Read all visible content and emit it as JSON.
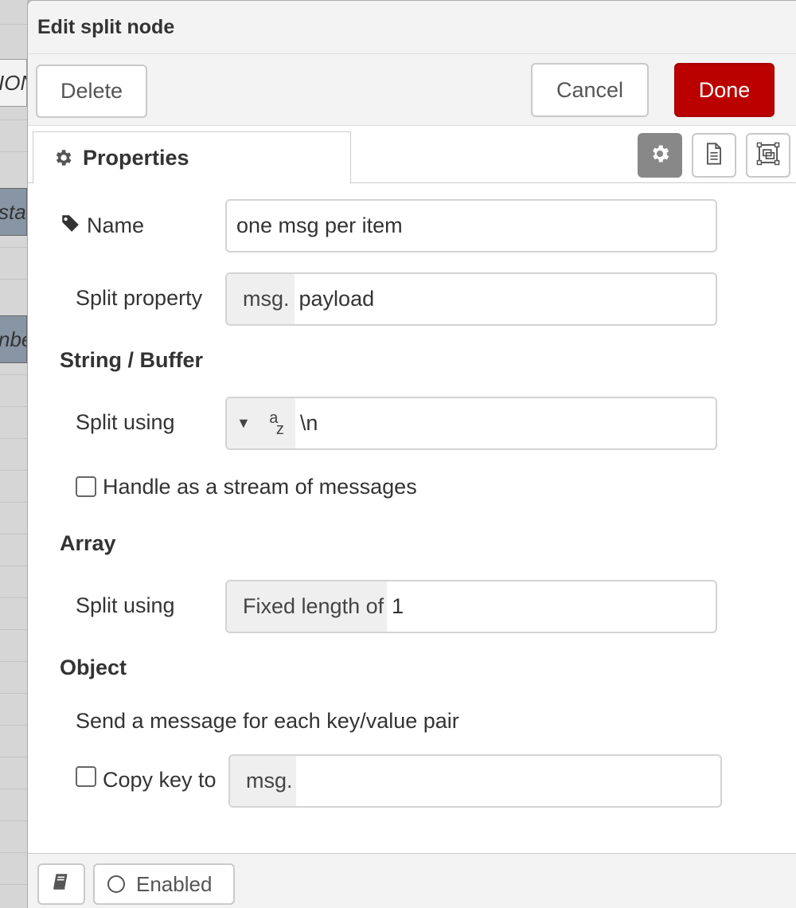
{
  "background": {
    "node_fragments": [
      "ION",
      "sta",
      "nbe"
    ]
  },
  "dialog": {
    "title": "Edit split node",
    "buttons": {
      "delete": "Delete",
      "cancel": "Cancel",
      "done": "Done"
    },
    "tabs": {
      "properties": "Properties"
    },
    "fields": {
      "name": {
        "label": "Name",
        "value": "one msg per item"
      },
      "split_property": {
        "label": "Split property",
        "prefix": "msg.",
        "value": "payload"
      }
    },
    "string_buffer": {
      "heading": "String / Buffer",
      "split_using_label": "Split using",
      "split_using_value": "\\n",
      "type_icon": "string-type-icon",
      "stream_checkbox_label": "Handle as a stream of messages",
      "stream_checked": false
    },
    "array": {
      "heading": "Array",
      "split_using_label": "Split using",
      "prefix": "Fixed length of",
      "value": "1"
    },
    "object": {
      "heading": "Object",
      "description": "Send a message for each key/value pair",
      "copy_key_label": "Copy key to",
      "copy_key_checked": false,
      "copy_key_prefix": "msg.",
      "copy_key_value": ""
    },
    "footer": {
      "enabled_label": "Enabled"
    }
  },
  "colors": {
    "done_button": "#bb0000",
    "active_tab_button": "#888888"
  }
}
